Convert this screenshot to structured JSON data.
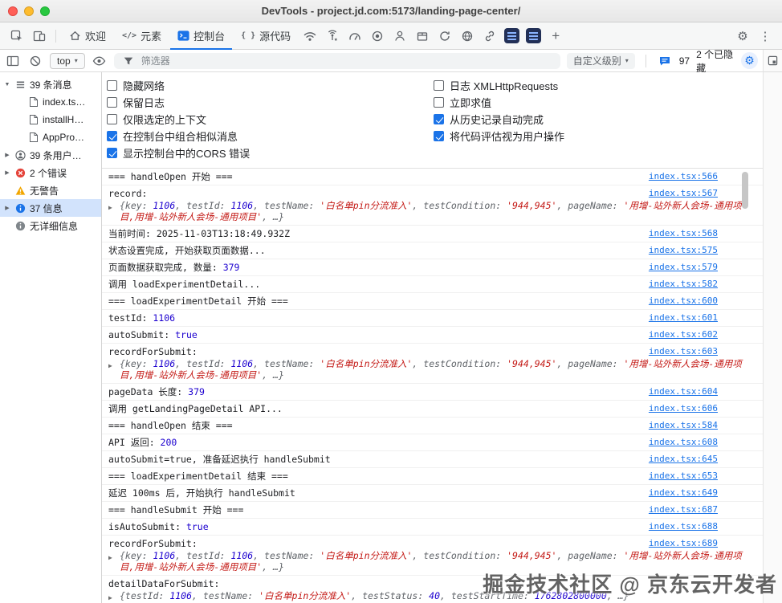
{
  "window": {
    "title": "DevTools - project.jd.com:5173/landing-page-center/"
  },
  "tabbar": {
    "left_icons": [
      "inspect-icon",
      "device-toolbar-icon"
    ],
    "tabs": [
      {
        "label": "欢迎",
        "icon": "home-icon",
        "active": false
      },
      {
        "label": "元素",
        "icon": "elements-icon",
        "active": false
      },
      {
        "label": "控制台",
        "icon": "console-icon",
        "active": true
      },
      {
        "label": "源代码",
        "icon": "sources-icon",
        "active": false
      }
    ],
    "panel_icons": [
      "wifi-icon",
      "signal-star-icon",
      "performance-icon",
      "recorder-icon",
      "user-icon",
      "package-icon",
      "sync-icon",
      "globe-icon",
      "link-icon",
      "extension-icon-1",
      "extension-icon-2",
      "more-tabs-icon"
    ],
    "right_icons": [
      "settings-gear-icon",
      "more-options-icon"
    ]
  },
  "console_toolbar": {
    "context_selector": "top",
    "filter_placeholder": "筛选器",
    "levels_label": "自定义级别",
    "message_count": "97",
    "hidden_label": "2 个已隐藏"
  },
  "sidebar": {
    "items": [
      {
        "label": "39 条消息",
        "icon": "list-icon",
        "selected": false
      },
      {
        "label": "index.ts…",
        "icon": "file-icon",
        "selected": false
      },
      {
        "label": "installH…",
        "icon": "file-icon",
        "selected": false
      },
      {
        "label": "AppPro…",
        "icon": "file-icon",
        "selected": false
      },
      {
        "label": "39 条用户…",
        "icon": "user-circle-icon",
        "selected": false
      },
      {
        "label": "2 个错误",
        "icon": "error-icon",
        "selected": false
      },
      {
        "label": "无警告",
        "icon": "warning-icon",
        "selected": false
      },
      {
        "label": "37 信息",
        "icon": "info-icon",
        "selected": true
      },
      {
        "label": "无详细信息",
        "icon": "verbose-icon",
        "selected": false
      }
    ]
  },
  "settings": {
    "left": [
      {
        "label": "隐藏网络",
        "checked": false
      },
      {
        "label": "保留日志",
        "checked": false
      },
      {
        "label": "仅限选定的上下文",
        "checked": false
      },
      {
        "label": "在控制台中组合相似消息",
        "checked": true
      },
      {
        "label": "显示控制台中的CORS 错误",
        "checked": true
      }
    ],
    "right": [
      {
        "label": "日志 XMLHttpRequests",
        "checked": false
      },
      {
        "label": "立即求值",
        "checked": false
      },
      {
        "label": "从历史记录自动完成",
        "checked": true
      },
      {
        "label": "将代码评估视为用户操作",
        "checked": true
      }
    ]
  },
  "messages": [
    {
      "parts": [
        {
          "t": "=== handleOpen 开始 ===",
          "c": "p"
        }
      ],
      "link": "index.tsx:566"
    },
    {
      "parts": [
        {
          "t": "record:",
          "c": "p"
        }
      ],
      "link": "index.tsx:567",
      "preview": [
        {
          "t": "{key: ",
          "c": "pv"
        },
        {
          "t": "1106",
          "c": "pvn"
        },
        {
          "t": ", testId: ",
          "c": "pv"
        },
        {
          "t": "1106",
          "c": "pvn"
        },
        {
          "t": ", testName: ",
          "c": "pv"
        },
        {
          "t": "'白名单pin分流准入'",
          "c": "pvs"
        },
        {
          "t": ", testCondition: ",
          "c": "pv"
        },
        {
          "t": "'944,945'",
          "c": "pvs"
        },
        {
          "t": ", pageName: ",
          "c": "pv"
        },
        {
          "t": "'用增-站外新人会场-通用项目,用增-站外新人会场-通用项目'",
          "c": "pvs"
        },
        {
          "t": ", …}",
          "c": "pv"
        }
      ]
    },
    {
      "parts": [
        {
          "t": "当前时间: 2025-11-03T13:18:49.932Z",
          "c": "p"
        }
      ],
      "link": "index.tsx:568"
    },
    {
      "parts": [
        {
          "t": "状态设置完成, 开始获取页面数据...",
          "c": "p"
        }
      ],
      "link": "index.tsx:575"
    },
    {
      "parts": [
        {
          "t": "页面数据获取完成, 数量: ",
          "c": "p"
        },
        {
          "t": "379",
          "c": "n"
        }
      ],
      "link": "index.tsx:579"
    },
    {
      "parts": [
        {
          "t": "调用 loadExperimentDetail...",
          "c": "p"
        }
      ],
      "link": "index.tsx:582"
    },
    {
      "parts": [
        {
          "t": "=== loadExperimentDetail 开始 ===",
          "c": "p"
        }
      ],
      "link": "index.tsx:600"
    },
    {
      "parts": [
        {
          "t": "testId: ",
          "c": "p"
        },
        {
          "t": "1106",
          "c": "n"
        }
      ],
      "link": "index.tsx:601"
    },
    {
      "parts": [
        {
          "t": "autoSubmit: ",
          "c": "p"
        },
        {
          "t": "true",
          "c": "n"
        }
      ],
      "link": "index.tsx:602"
    },
    {
      "parts": [
        {
          "t": "recordForSubmit:",
          "c": "p"
        }
      ],
      "link": "index.tsx:603",
      "preview": [
        {
          "t": "{key: ",
          "c": "pv"
        },
        {
          "t": "1106",
          "c": "pvn"
        },
        {
          "t": ", testId: ",
          "c": "pv"
        },
        {
          "t": "1106",
          "c": "pvn"
        },
        {
          "t": ", testName: ",
          "c": "pv"
        },
        {
          "t": "'白名单pin分流准入'",
          "c": "pvs"
        },
        {
          "t": ", testCondition: ",
          "c": "pv"
        },
        {
          "t": "'944,945'",
          "c": "pvs"
        },
        {
          "t": ", pageName: ",
          "c": "pv"
        },
        {
          "t": "'用增-站外新人会场-通用项目,用增-站外新人会场-通用项目'",
          "c": "pvs"
        },
        {
          "t": ", …}",
          "c": "pv"
        }
      ]
    },
    {
      "parts": [
        {
          "t": "pageData 长度: ",
          "c": "p"
        },
        {
          "t": "379",
          "c": "n"
        }
      ],
      "link": "index.tsx:604"
    },
    {
      "parts": [
        {
          "t": "调用 getLandingPageDetail API...",
          "c": "p"
        }
      ],
      "link": "index.tsx:606"
    },
    {
      "parts": [
        {
          "t": "=== handleOpen 结束 ===",
          "c": "p"
        }
      ],
      "link": "index.tsx:584"
    },
    {
      "parts": [
        {
          "t": "API 返回: ",
          "c": "p"
        },
        {
          "t": "200",
          "c": "n"
        }
      ],
      "link": "index.tsx:608"
    },
    {
      "parts": [
        {
          "t": "autoSubmit=true, 准备延迟执行 handleSubmit",
          "c": "p"
        }
      ],
      "link": "index.tsx:645"
    },
    {
      "parts": [
        {
          "t": "=== loadExperimentDetail 结束 ===",
          "c": "p"
        }
      ],
      "link": "index.tsx:653"
    },
    {
      "parts": [
        {
          "t": "延迟 100ms 后, 开始执行 handleSubmit",
          "c": "p"
        }
      ],
      "link": "index.tsx:649"
    },
    {
      "parts": [
        {
          "t": "=== handleSubmit 开始 ===",
          "c": "p"
        }
      ],
      "link": "index.tsx:687"
    },
    {
      "parts": [
        {
          "t": "isAutoSubmit: ",
          "c": "p"
        },
        {
          "t": "true",
          "c": "n"
        }
      ],
      "link": "index.tsx:688"
    },
    {
      "parts": [
        {
          "t": "recordForSubmit:",
          "c": "p"
        }
      ],
      "link": "index.tsx:689",
      "preview": [
        {
          "t": "{key: ",
          "c": "pv"
        },
        {
          "t": "1106",
          "c": "pvn"
        },
        {
          "t": ", testId: ",
          "c": "pv"
        },
        {
          "t": "1106",
          "c": "pvn"
        },
        {
          "t": ", testName: ",
          "c": "pv"
        },
        {
          "t": "'白名单pin分流准入'",
          "c": "pvs"
        },
        {
          "t": ", testCondition: ",
          "c": "pv"
        },
        {
          "t": "'944,945'",
          "c": "pvs"
        },
        {
          "t": ", pageName: ",
          "c": "pv"
        },
        {
          "t": "'用增-站外新人会场-通用项目,用增-站外新人会场-通用项目'",
          "c": "pvs"
        },
        {
          "t": ", …}",
          "c": "pv"
        }
      ]
    },
    {
      "parts": [
        {
          "t": "detailDataForSubmit:",
          "c": "p"
        }
      ],
      "link": "",
      "preview": [
        {
          "t": "{testId: ",
          "c": "pv"
        },
        {
          "t": "1106",
          "c": "pvn"
        },
        {
          "t": ", testName: ",
          "c": "pv"
        },
        {
          "t": "'白名单pin分流准入'",
          "c": "pvs"
        },
        {
          "t": ", testStatus: ",
          "c": "pv"
        },
        {
          "t": "40",
          "c": "pvn"
        },
        {
          "t": ", testStartTime: ",
          "c": "pv"
        },
        {
          "t": "1762802800000",
          "c": "pvn"
        },
        {
          "t": ", …}",
          "c": "pv"
        }
      ]
    }
  ],
  "watermark": "掘金技术社区 @ 京东云开发者"
}
